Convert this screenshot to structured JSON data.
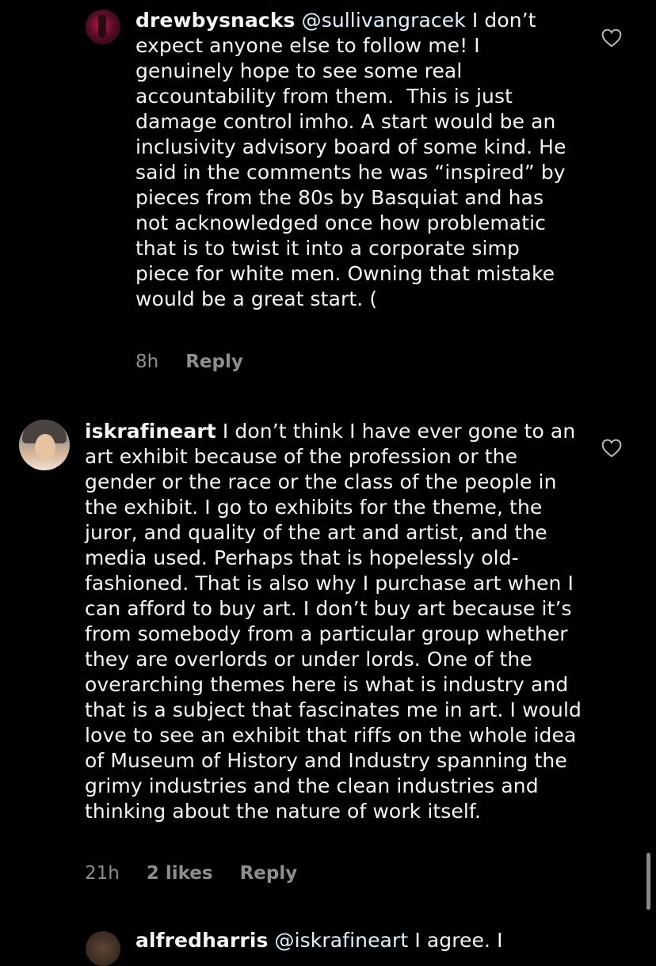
{
  "comments": [
    {
      "username": "drewbysnacks",
      "mention": "@sullivangracek",
      "text": "I don’t expect anyone else to follow me! I genuinely hope to see some real accountability from them.  This is just damage control imho. A start would be an inclusivity advisory board of some kind. He said in the comments he was “inspired” by pieces from the 80s by Basquiat and has not acknowledged once how problematic that is to twist it into a corporate simp piece for white men. Owning that mistake would be a great start. (",
      "time": "8h",
      "reply": "Reply"
    },
    {
      "username": "iskrafineart",
      "text": "I don’t think I have ever gone to an art exhibit because of the profession or the gender or the race or the class of the people in the exhibit. I go to exhibits for the theme, the juror, and quality of the art and artist, and the media used. Perhaps that is hopelessly old-fashioned. That is also why I purchase art when I can afford to buy art. I don’t buy art because it’s from somebody from a particular group whether they are overlords or under lords. One of the overarching themes here is what is industry and that is a subject that fascinates me in art. I would love to see an exhibit that riffs on the whole idea of Museum of History and Industry spanning the grimy industries and the clean industries and thinking about the nature of work itself.",
      "time": "21h",
      "likes": "2 likes",
      "reply": "Reply"
    },
    {
      "username": "alfredharris",
      "mention": "@iskrafineart",
      "text": "I agree. I"
    }
  ],
  "icons": {
    "like": "heart-outline-icon"
  },
  "colors": {
    "background": "#000000",
    "text": "#f5f5f5",
    "meta": "#8e8e8e"
  }
}
